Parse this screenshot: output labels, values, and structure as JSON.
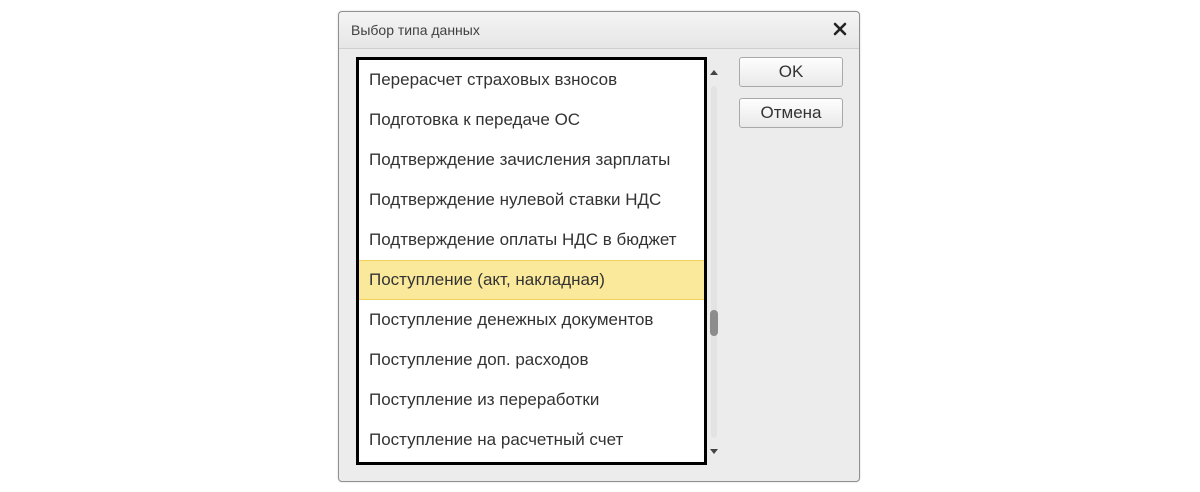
{
  "dialog": {
    "title": "Выбор типа данных",
    "close_icon": "close-icon",
    "ok_label": "OK",
    "cancel_label": "Отмена"
  },
  "list": {
    "selected_index": 5,
    "highlight_color": "#fbe99b",
    "items": [
      {
        "label": "Перерасчет страховых взносов"
      },
      {
        "label": "Подготовка к передаче ОС"
      },
      {
        "label": "Подтверждение зачисления зарплаты"
      },
      {
        "label": "Подтверждение нулевой ставки НДС"
      },
      {
        "label": "Подтверждение оплаты НДС в бюджет"
      },
      {
        "label": "Поступление (акт, накладная)"
      },
      {
        "label": "Поступление денежных документов"
      },
      {
        "label": "Поступление доп. расходов"
      },
      {
        "label": "Поступление из переработки"
      },
      {
        "label": "Поступление на расчетный счет"
      }
    ]
  },
  "scrollbar": {
    "up_icon": "arrow-up-icon",
    "down_icon": "arrow-down-icon"
  }
}
